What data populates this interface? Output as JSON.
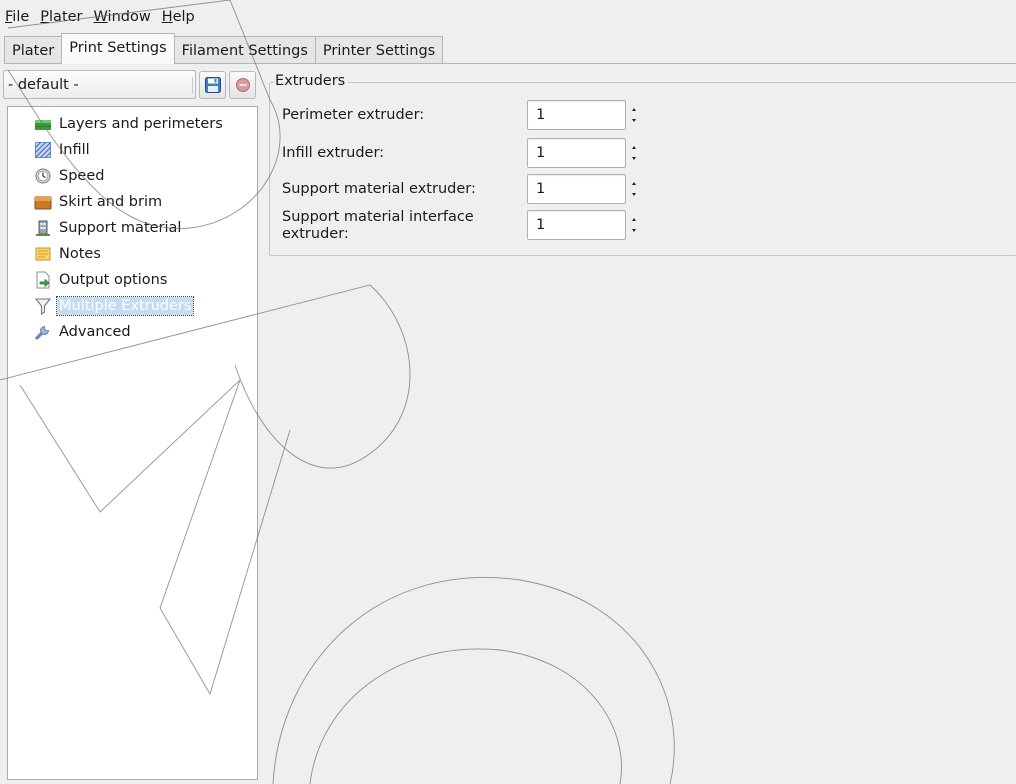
{
  "menubar": {
    "items": [
      {
        "mnemonic": "F",
        "rest": "ile"
      },
      {
        "mnemonic": "P",
        "rest": "later"
      },
      {
        "mnemonic": "W",
        "rest": "indow"
      },
      {
        "mnemonic": "H",
        "rest": "elp"
      }
    ]
  },
  "tabs": [
    {
      "label": "Plater"
    },
    {
      "label": "Print Settings"
    },
    {
      "label": "Filament Settings"
    },
    {
      "label": "Printer Settings"
    }
  ],
  "active_tab": "Print Settings",
  "preset": {
    "selected": "- default -"
  },
  "pages": [
    {
      "label": "Layers and perimeters",
      "icon": "layers-icon"
    },
    {
      "label": "Infill",
      "icon": "infill-icon"
    },
    {
      "label": "Speed",
      "icon": "speed-icon"
    },
    {
      "label": "Skirt and brim",
      "icon": "skirt-icon"
    },
    {
      "label": "Support material",
      "icon": "support-icon"
    },
    {
      "label": "Notes",
      "icon": "notes-icon"
    },
    {
      "label": "Output options",
      "icon": "output-icon"
    },
    {
      "label": "Multiple Extruders",
      "icon": "funnel-icon"
    },
    {
      "label": "Advanced",
      "icon": "wrench-icon"
    }
  ],
  "selected_page": "Multiple Extruders",
  "extruders": {
    "title": "Extruders",
    "fields": [
      {
        "label": "Perimeter extruder:",
        "value": "1"
      },
      {
        "label": "Infill extruder:",
        "value": "1"
      },
      {
        "label": "Support material extruder:",
        "value": "1"
      },
      {
        "label": "Support material interface extruder:",
        "label_line1": "Support material interface",
        "label_line2": "extruder:",
        "value": "1"
      }
    ]
  },
  "colors": {
    "selection": "#c6dcf3",
    "background": "#efefef"
  }
}
